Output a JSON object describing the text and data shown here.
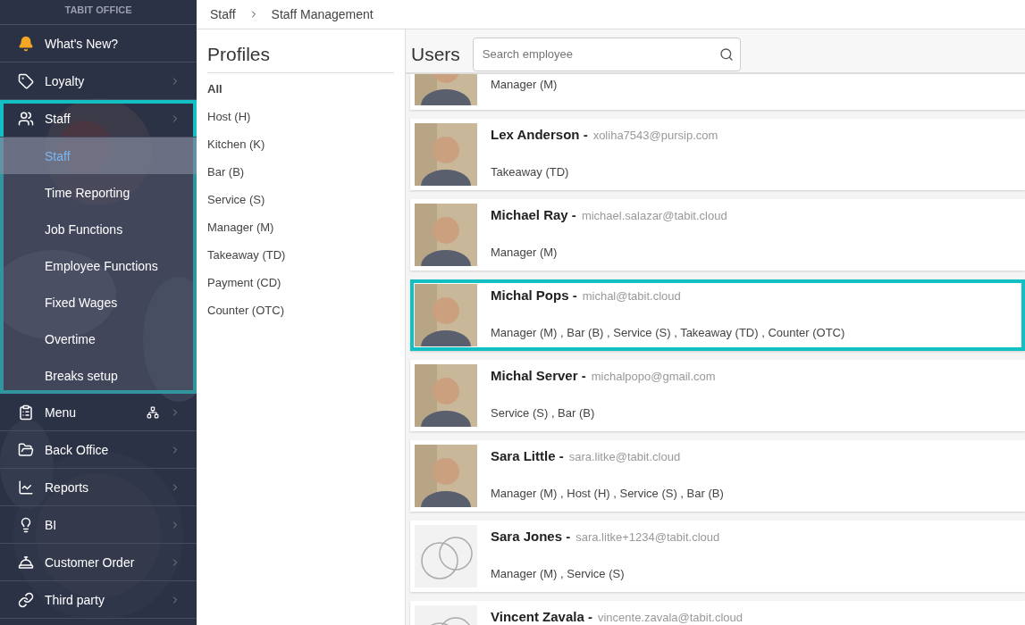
{
  "sidebar": {
    "brand": "TABIT OFFICE",
    "items": [
      {
        "label": "What's New?",
        "chevron": false,
        "highlighted": false
      },
      {
        "label": "Loyalty",
        "chevron": true,
        "highlighted": false
      },
      {
        "label": "Staff",
        "chevron": true,
        "highlighted": true,
        "children": [
          {
            "label": "Staff",
            "selected": true
          },
          {
            "label": "Time Reporting",
            "selected": false
          },
          {
            "label": "Job Functions",
            "selected": false
          },
          {
            "label": "Employee Functions",
            "selected": false
          },
          {
            "label": "Fixed Wages",
            "selected": false
          },
          {
            "label": "Overtime",
            "selected": false
          },
          {
            "label": "Breaks setup",
            "selected": false
          }
        ]
      },
      {
        "label": "Menu",
        "chevron": true,
        "highlighted": false,
        "extra_icon": true
      },
      {
        "label": "Back Office",
        "chevron": true,
        "highlighted": false
      },
      {
        "label": "Reports",
        "chevron": true,
        "highlighted": false
      },
      {
        "label": "BI",
        "chevron": true,
        "highlighted": false
      },
      {
        "label": "Customer Order",
        "chevron": true,
        "highlighted": false
      },
      {
        "label": "Third party",
        "chevron": true,
        "highlighted": false
      }
    ]
  },
  "breadcrumb": [
    "Staff",
    "Staff Management"
  ],
  "profiles": {
    "title": "Profiles",
    "items": [
      {
        "label": "All",
        "selected": true
      },
      {
        "label": "Host (H)",
        "selected": false
      },
      {
        "label": "Kitchen (K)",
        "selected": false
      },
      {
        "label": "Bar (B)",
        "selected": false
      },
      {
        "label": "Service (S)",
        "selected": false
      },
      {
        "label": "Manager (M)",
        "selected": false
      },
      {
        "label": "Takeaway (TD)",
        "selected": false
      },
      {
        "label": "Payment (CD)",
        "selected": false
      },
      {
        "label": "Counter (OTC)",
        "selected": false
      }
    ]
  },
  "users": {
    "title": "Users",
    "search": {
      "placeholder": "Search employee"
    },
    "items": [
      {
        "kind": "picture",
        "roles": "Manager (M)",
        "highlighted": false
      },
      {
        "kind": "picture",
        "name": "Lex Anderson -",
        "email": "xoliha7543@pursip.com",
        "roles": "Takeaway (TD)",
        "highlighted": false
      },
      {
        "kind": "picture",
        "name": "Michael Ray -",
        "email": "michael.salazar@tabit.cloud",
        "roles": "Manager (M)",
        "highlighted": false
      },
      {
        "kind": "picture",
        "name": "Michal Pops -",
        "email": "michal@tabit.cloud",
        "roles": "Manager (M) , Bar (B) , Service (S) , Takeaway (TD) , Counter (OTC)",
        "highlighted": true
      },
      {
        "kind": "picture",
        "name": "Michal Server -",
        "email": "michalpopo@gmail.com",
        "roles": "Service (S) , Bar (B)",
        "highlighted": false
      },
      {
        "kind": "picture",
        "name": "Sara Little -",
        "email": "sara.litke@tabit.cloud",
        "roles": "Manager (M) , Host (H) , Service (S) , Bar (B)",
        "highlighted": false
      },
      {
        "kind": "placeholder",
        "name": "Sara Jones -",
        "email": "sara.litke+1234@tabit.cloud",
        "roles": "Manager (M) , Service (S)",
        "highlighted": false
      },
      {
        "kind": "placeholder",
        "name": "Vincent Zavala -",
        "email": "vincente.zavala@tabit.cloud",
        "highlighted": false
      }
    ]
  }
}
